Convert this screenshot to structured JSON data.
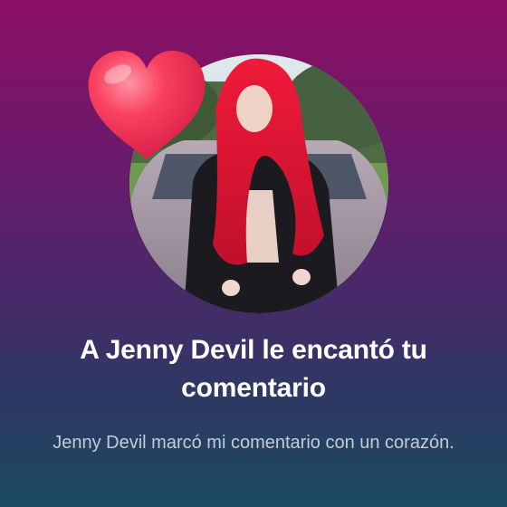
{
  "notification": {
    "title": "A Jenny Devil le encantó tu comentario",
    "subtitle": "Jenny Devil marcó mi comentario con un corazón."
  },
  "colors": {
    "background_top": "#8b0f63",
    "background_bottom": "#1b4a62",
    "heart": "#f0304f",
    "title_text": "#ffffff",
    "subtitle_text": "#c5cbd8"
  },
  "icons": {
    "reaction": "heart-icon"
  }
}
